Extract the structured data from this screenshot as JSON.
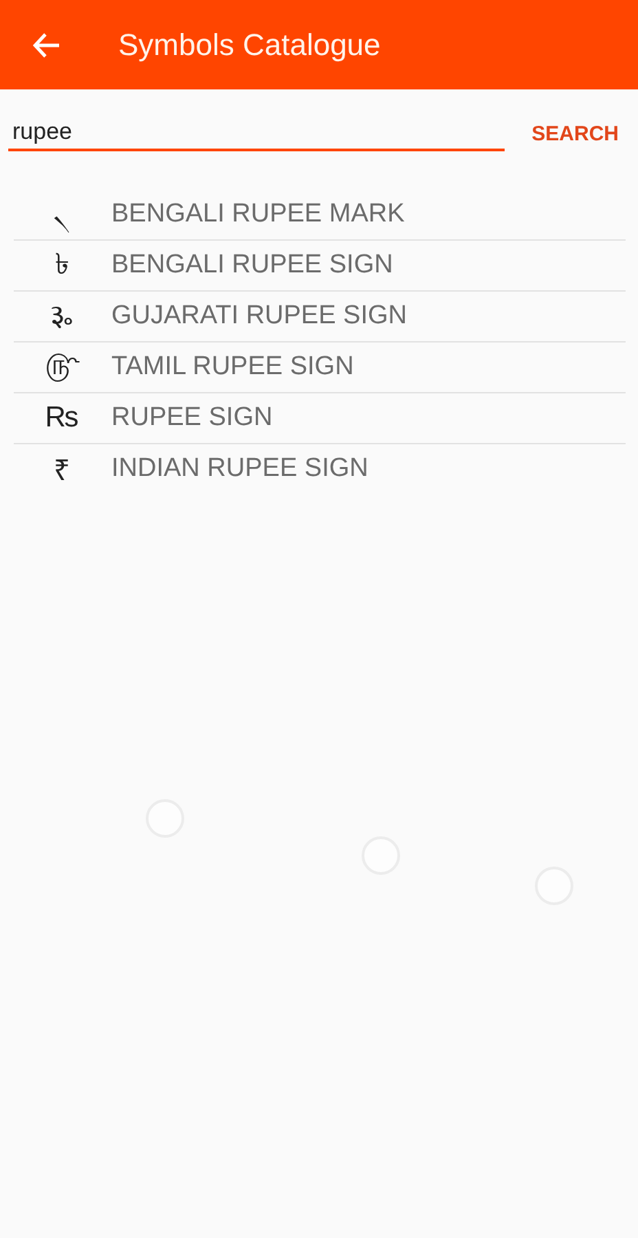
{
  "app_bar": {
    "title": "Symbols Catalogue"
  },
  "search": {
    "value": "rupee",
    "button": "SEARCH"
  },
  "symbols": [
    {
      "glyph": "৲",
      "name": "BENGALI RUPEE MARK"
    },
    {
      "glyph": "৳",
      "name": "BENGALI RUPEE SIGN"
    },
    {
      "glyph": "૱",
      "name": "GUJARATI RUPEE SIGN"
    },
    {
      "glyph": "௹",
      "name": "TAMIL RUPEE SIGN"
    },
    {
      "glyph": "₨",
      "name": "RUPEE SIGN"
    },
    {
      "glyph": "₹",
      "name": "INDIAN RUPEE SIGN"
    }
  ]
}
